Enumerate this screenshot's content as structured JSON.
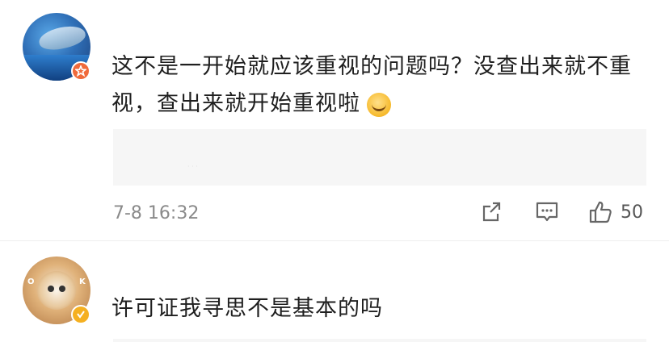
{
  "comments": [
    {
      "text": "这不是一开始就应该重视的问题吗？没查出来就不重视，查出来就开始重视啦",
      "emoji": "laugh-cry-emoji",
      "time": "7-8 16:32",
      "likes": "50",
      "badge": "red-star-badge"
    },
    {
      "text": "许可证我寻思不是基本的吗",
      "badge": "gold-verified-badge",
      "avatar_letters": [
        "O",
        "K"
      ]
    }
  ],
  "icons": {
    "share": "share-icon",
    "comment": "comment-icon",
    "like": "thumb-up-icon"
  },
  "colors": {
    "badge_red": "#f06a3b",
    "badge_gold": "#f5b021",
    "meta_gray": "#8a8a8a",
    "reply_bg": "#f6f6f6"
  }
}
